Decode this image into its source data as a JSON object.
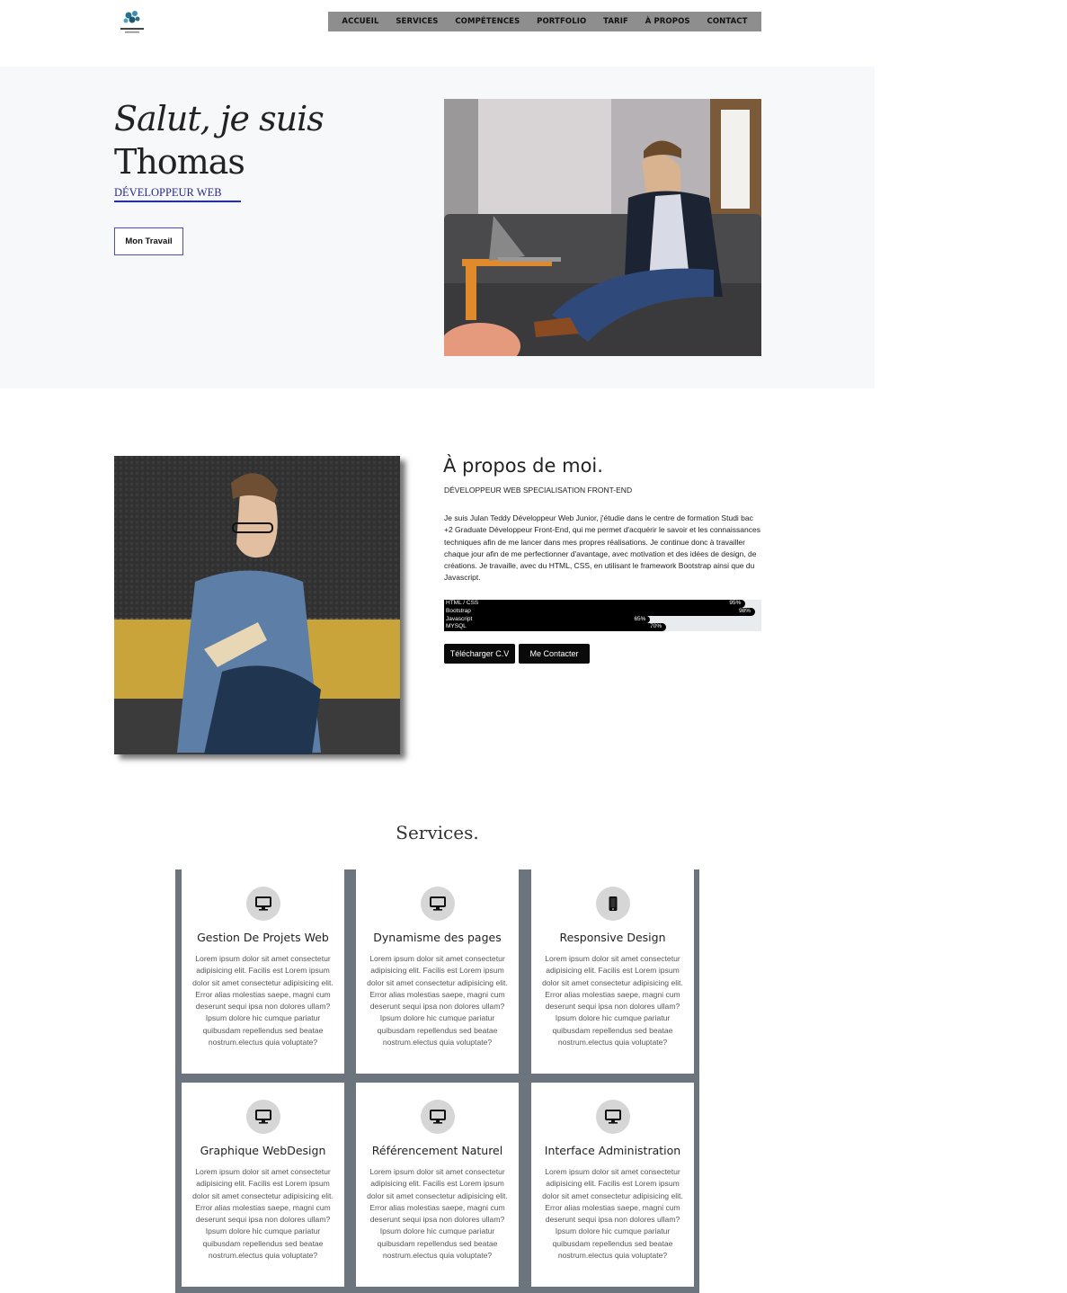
{
  "header": {
    "logo_alt": "Lorem ipsum",
    "nav": [
      "ACCUEIL",
      "SERVICES",
      "COMPÉTENCES",
      "PORTFOLIO",
      "TARIF",
      "À PROPOS",
      "CONTACT"
    ]
  },
  "hero": {
    "greeting": "Salut, je suis",
    "name": "Thomas",
    "role": "DÉVELOPPEUR WEB",
    "button": "Mon Travail"
  },
  "about": {
    "title": "À propos de moi.",
    "subtitle": "DÉVELOPPEUR WEB SPECIALISATION FRONT-END",
    "text": "Je suis Julan Teddy Développeur Web Junior, j'étudie dans le centre de formation Studi bac +2 Graduate Développeur Front-End, qui me permet d'acquérir le savoir et les connaissances techniques afin de me lancer dans mes propres réalisations. Je continue donc à travailler chaque jour afin de me perfectionner d'avantage, avec motivation et des idées de design, de créations. Je travaille, avec du HTML, CSS, en utilisant le framework Bootstrap ainsi que du Javascript.",
    "skills": [
      {
        "name": "HTML / CSS",
        "percent": 95,
        "label": "95%"
      },
      {
        "name": "Bootstrap",
        "percent": 98,
        "label": "98%"
      },
      {
        "name": "Javascript",
        "percent": 65,
        "label": "65%"
      },
      {
        "name": "MYSQL",
        "percent": 70,
        "label": "70%"
      }
    ],
    "btn_cv": "Télécharger C.V",
    "btn_contact": "Me Contacter"
  },
  "services": {
    "title": "Services.",
    "cards": [
      {
        "title": "Gestion De Projets Web",
        "icon": "desktop-icon",
        "text": "Lorem ipsum dolor sit amet consectetur adipisicing elit. Facilis est Lorem ipsum dolor sit amet consectetur adipisicing elit. Error alias molestias saepe, magni cum deserunt sequi ipsa non dolores ullam? Ipsum dolore hic cumque pariatur quibusdam repellendus sed beatae nostrum.electus quia voluptate?"
      },
      {
        "title": "Dynamisme des pages",
        "icon": "desktop-icon",
        "text": "Lorem ipsum dolor sit amet consectetur adipisicing elit. Facilis est Lorem ipsum dolor sit amet consectetur adipisicing elit. Error alias molestias saepe, magni cum deserunt sequi ipsa non dolores ullam? Ipsum dolore hic cumque pariatur quibusdam repellendus sed beatae nostrum.electus quia voluptate?"
      },
      {
        "title": "Responsive Design",
        "icon": "phone-icon",
        "text": "Lorem ipsum dolor sit amet consectetur adipisicing elit. Facilis est Lorem ipsum dolor sit amet consectetur adipisicing elit. Error alias molestias saepe, magni cum deserunt sequi ipsa non dolores ullam? Ipsum dolore hic cumque pariatur quibusdam repellendus sed beatae nostrum.electus quia voluptate?"
      },
      {
        "title": "Graphique WebDesign",
        "icon": "desktop-icon",
        "text": "Lorem ipsum dolor sit amet consectetur adipisicing elit. Facilis est Lorem ipsum dolor sit amet consectetur adipisicing elit. Error alias molestias saepe, magni cum deserunt sequi ipsa non dolores ullam? Ipsum dolore hic cumque pariatur quibusdam repellendus sed beatae nostrum.electus quia voluptate?"
      },
      {
        "title": "Référencement Naturel",
        "icon": "desktop-icon",
        "text": "Lorem ipsum dolor sit amet consectetur adipisicing elit. Facilis est Lorem ipsum dolor sit amet consectetur adipisicing elit. Error alias molestias saepe, magni cum deserunt sequi ipsa non dolores ullam? Ipsum dolore hic cumque pariatur quibusdam repellendus sed beatae nostrum.electus quia voluptate?"
      },
      {
        "title": "Interface Administration",
        "icon": "desktop-icon",
        "text": "Lorem ipsum dolor sit amet consectetur adipisicing elit. Facilis est Lorem ipsum dolor sit amet consectetur adipisicing elit. Error alias molestias saepe, magni cum deserunt sequi ipsa non dolores ullam? Ipsum dolore hic cumque pariatur quibusdam repellendus sed beatae nostrum.electus quia voluptate?"
      }
    ]
  }
}
